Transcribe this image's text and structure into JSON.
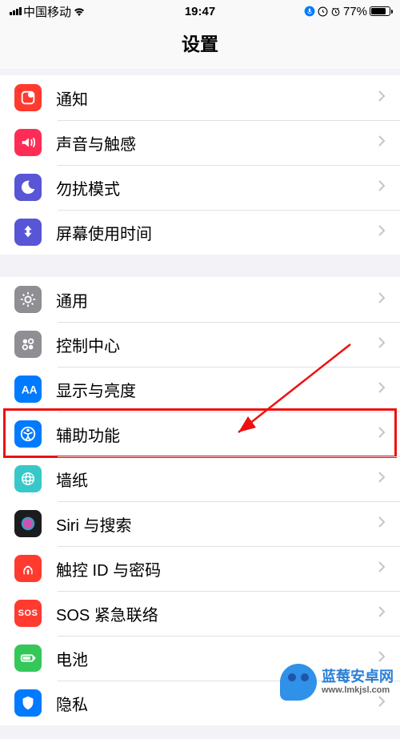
{
  "status": {
    "carrier": "中国移动",
    "time": "19:47",
    "battery": "77%"
  },
  "title": "设置",
  "groups": [
    {
      "rows": [
        {
          "id": "notifications",
          "label": "通知",
          "icon_name": "notifications-icon",
          "bg": "#ff3b30"
        },
        {
          "id": "sounds",
          "label": "声音与触感",
          "icon_name": "sounds-icon",
          "bg": "#ff2d55"
        },
        {
          "id": "dnd",
          "label": "勿扰模式",
          "icon_name": "dnd-icon",
          "bg": "#5856d6"
        },
        {
          "id": "screentime",
          "label": "屏幕使用时间",
          "icon_name": "screentime-icon",
          "bg": "#5856d6"
        }
      ]
    },
    {
      "rows": [
        {
          "id": "general",
          "label": "通用",
          "icon_name": "general-icon",
          "bg": "#8e8e93"
        },
        {
          "id": "control-center",
          "label": "控制中心",
          "icon_name": "control-center-icon",
          "bg": "#8e8e93"
        },
        {
          "id": "display",
          "label": "显示与亮度",
          "icon_name": "display-icon",
          "bg": "#007aff"
        },
        {
          "id": "accessibility",
          "label": "辅助功能",
          "icon_name": "accessibility-icon",
          "bg": "#007aff",
          "highlighted": true
        },
        {
          "id": "wallpaper",
          "label": "墙纸",
          "icon_name": "wallpaper-icon",
          "bg": "#38c8c9"
        },
        {
          "id": "siri",
          "label": "Siri 与搜索",
          "icon_name": "siri-icon",
          "bg": "#1c1c1e"
        },
        {
          "id": "touchid",
          "label": "触控 ID 与密码",
          "icon_name": "touchid-icon",
          "bg": "#ff3b30"
        },
        {
          "id": "sos",
          "label": "SOS 紧急联络",
          "icon_name": "sos-icon",
          "bg": "#ff3b30",
          "text_icon": "SOS"
        },
        {
          "id": "battery",
          "label": "电池",
          "icon_name": "battery-icon",
          "bg": "#34c759"
        },
        {
          "id": "privacy",
          "label": "隐私",
          "icon_name": "privacy-icon",
          "bg": "#007aff"
        }
      ]
    }
  ],
  "watermark": {
    "line1": "蓝莓安卓网",
    "line2": "www.lmkjsl.com"
  }
}
